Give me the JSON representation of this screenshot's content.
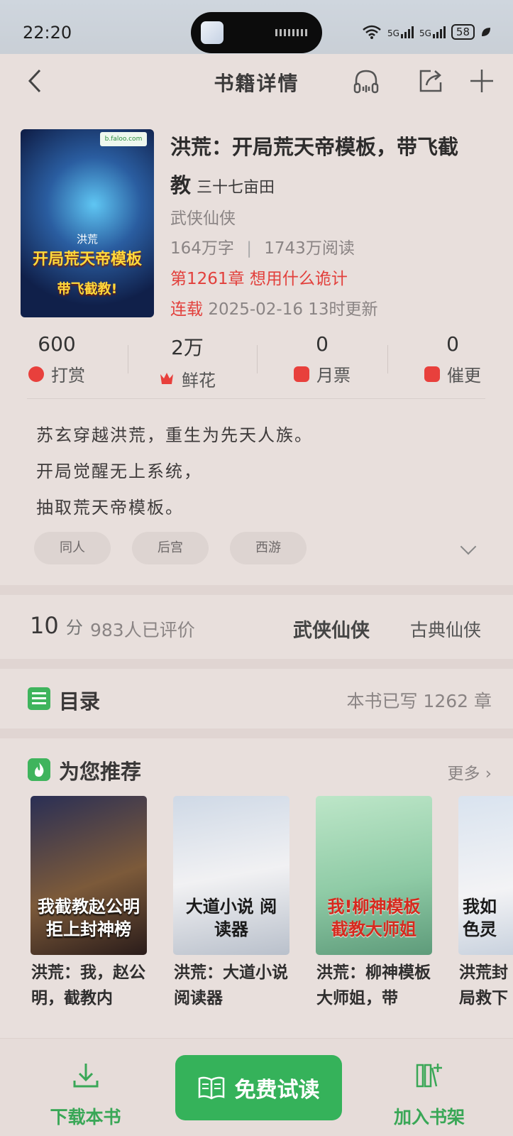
{
  "status": {
    "time": "22:20",
    "battery": "58"
  },
  "nav": {
    "title": "书籍详情"
  },
  "book": {
    "cover_line0": "洪荒",
    "cover_line1": "开局荒天帝模板",
    "cover_line2": "带飞截教!",
    "title": "洪荒：开局荒天帝模板，带飞截教",
    "author": "三十七亩田",
    "category": "武侠仙侠",
    "words": "164万字",
    "reads": "1743万阅读",
    "latest_chapter": "第1261章 想用什么诡计",
    "serial_status": "连载",
    "update_time": "2025-02-16 13时更新"
  },
  "stats": [
    {
      "num": "600",
      "label": "打赏"
    },
    {
      "num": "2万",
      "label": "鲜花"
    },
    {
      "num": "0",
      "label": "月票"
    },
    {
      "num": "0",
      "label": "催更"
    }
  ],
  "intro": [
    "苏玄穿越洪荒，重生为先天人族。",
    "开局觉醒无上系统，",
    "抽取荒天帝模板。"
  ],
  "tags": [
    "同人",
    "后宫",
    "西游"
  ],
  "rating": {
    "score": "10",
    "unit": "分",
    "count": "983人已评价",
    "category_main": "武侠仙侠",
    "category_sub": "古典仙侠"
  },
  "toc": {
    "title": "目录",
    "count": "本书已写 1262 章"
  },
  "recommend": {
    "title": "为您推荐",
    "more": "更多",
    "books": [
      {
        "name": "洪荒：我，赵公明，截教内",
        "cover_text": "我截教赵公明 拒上封神榜"
      },
      {
        "name": "洪荒：大道小说阅读器",
        "cover_text": "大道小说 阅读器"
      },
      {
        "name": "洪荒：柳神模板大师姐，带",
        "cover_text": "我!柳神模板 截教大师姐"
      },
      {
        "name": "洪荒封局救下",
        "cover_text": "我如 色灵"
      }
    ]
  },
  "bottom": {
    "download": "下载本书",
    "read": "免费试读",
    "shelf": "加入书架"
  },
  "colors": {
    "accent": "#35b25a",
    "highlight": "#e2403c"
  }
}
